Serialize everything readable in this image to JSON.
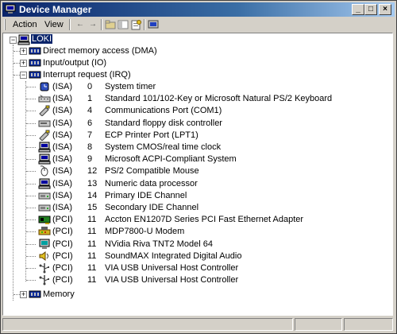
{
  "window": {
    "title": "Device Manager"
  },
  "title_buttons": {
    "minimize": "_",
    "maximize": "□",
    "close": "×"
  },
  "menu": {
    "action": "Action",
    "view": "View"
  },
  "tree": {
    "root": "LOKI",
    "categories": {
      "dma": "Direct memory access (DMA)",
      "io": "Input/output (IO)",
      "irq": "Interrupt request (IRQ)",
      "memory": "Memory"
    },
    "irq_items": [
      {
        "src": "(ISA)",
        "num": "0",
        "name": "System timer",
        "icon": "system-timer-icon"
      },
      {
        "src": "(ISA)",
        "num": "1",
        "name": "Standard 101/102-Key or Microsoft Natural PS/2 Keyboard",
        "icon": "keyboard-icon"
      },
      {
        "src": "(ISA)",
        "num": "4",
        "name": "Communications Port (COM1)",
        "icon": "port-icon"
      },
      {
        "src": "(ISA)",
        "num": "6",
        "name": "Standard floppy disk controller",
        "icon": "floppy-controller-icon"
      },
      {
        "src": "(ISA)",
        "num": "7",
        "name": "ECP Printer Port (LPT1)",
        "icon": "port-icon"
      },
      {
        "src": "(ISA)",
        "num": "8",
        "name": "System CMOS/real time clock",
        "icon": "system-device-icon"
      },
      {
        "src": "(ISA)",
        "num": "9",
        "name": "Microsoft ACPI-Compliant System",
        "icon": "system-device-icon"
      },
      {
        "src": "(ISA)",
        "num": "12",
        "name": "PS/2 Compatible Mouse",
        "icon": "mouse-icon"
      },
      {
        "src": "(ISA)",
        "num": "13",
        "name": "Numeric data processor",
        "icon": "system-device-icon"
      },
      {
        "src": "(ISA)",
        "num": "14",
        "name": "Primary IDE Channel",
        "icon": "ide-controller-icon"
      },
      {
        "src": "(ISA)",
        "num": "15",
        "name": "Secondary IDE Channel",
        "icon": "ide-controller-icon"
      },
      {
        "src": "(PCI)",
        "num": "11",
        "name": "Accton EN1207D Series PCI Fast Ethernet Adapter",
        "icon": "network-adapter-icon"
      },
      {
        "src": "(PCI)",
        "num": "11",
        "name": "MDP7800-U Modem",
        "icon": "modem-icon"
      },
      {
        "src": "(PCI)",
        "num": "11",
        "name": "NVidia Riva TNT2 Model 64",
        "icon": "display-adapter-icon"
      },
      {
        "src": "(PCI)",
        "num": "11",
        "name": "SoundMAX Integrated Digital Audio",
        "icon": "sound-icon"
      },
      {
        "src": "(PCI)",
        "num": "11",
        "name": "VIA USB Universal Host Controller",
        "icon": "usb-icon"
      },
      {
        "src": "(PCI)",
        "num": "11",
        "name": "VIA USB Universal Host Controller",
        "icon": "usb-icon"
      }
    ]
  },
  "colors": {
    "title_start": "#0a246a",
    "title_end": "#a6caf0",
    "face": "#d4d0c8",
    "selection": "#0a246a"
  }
}
